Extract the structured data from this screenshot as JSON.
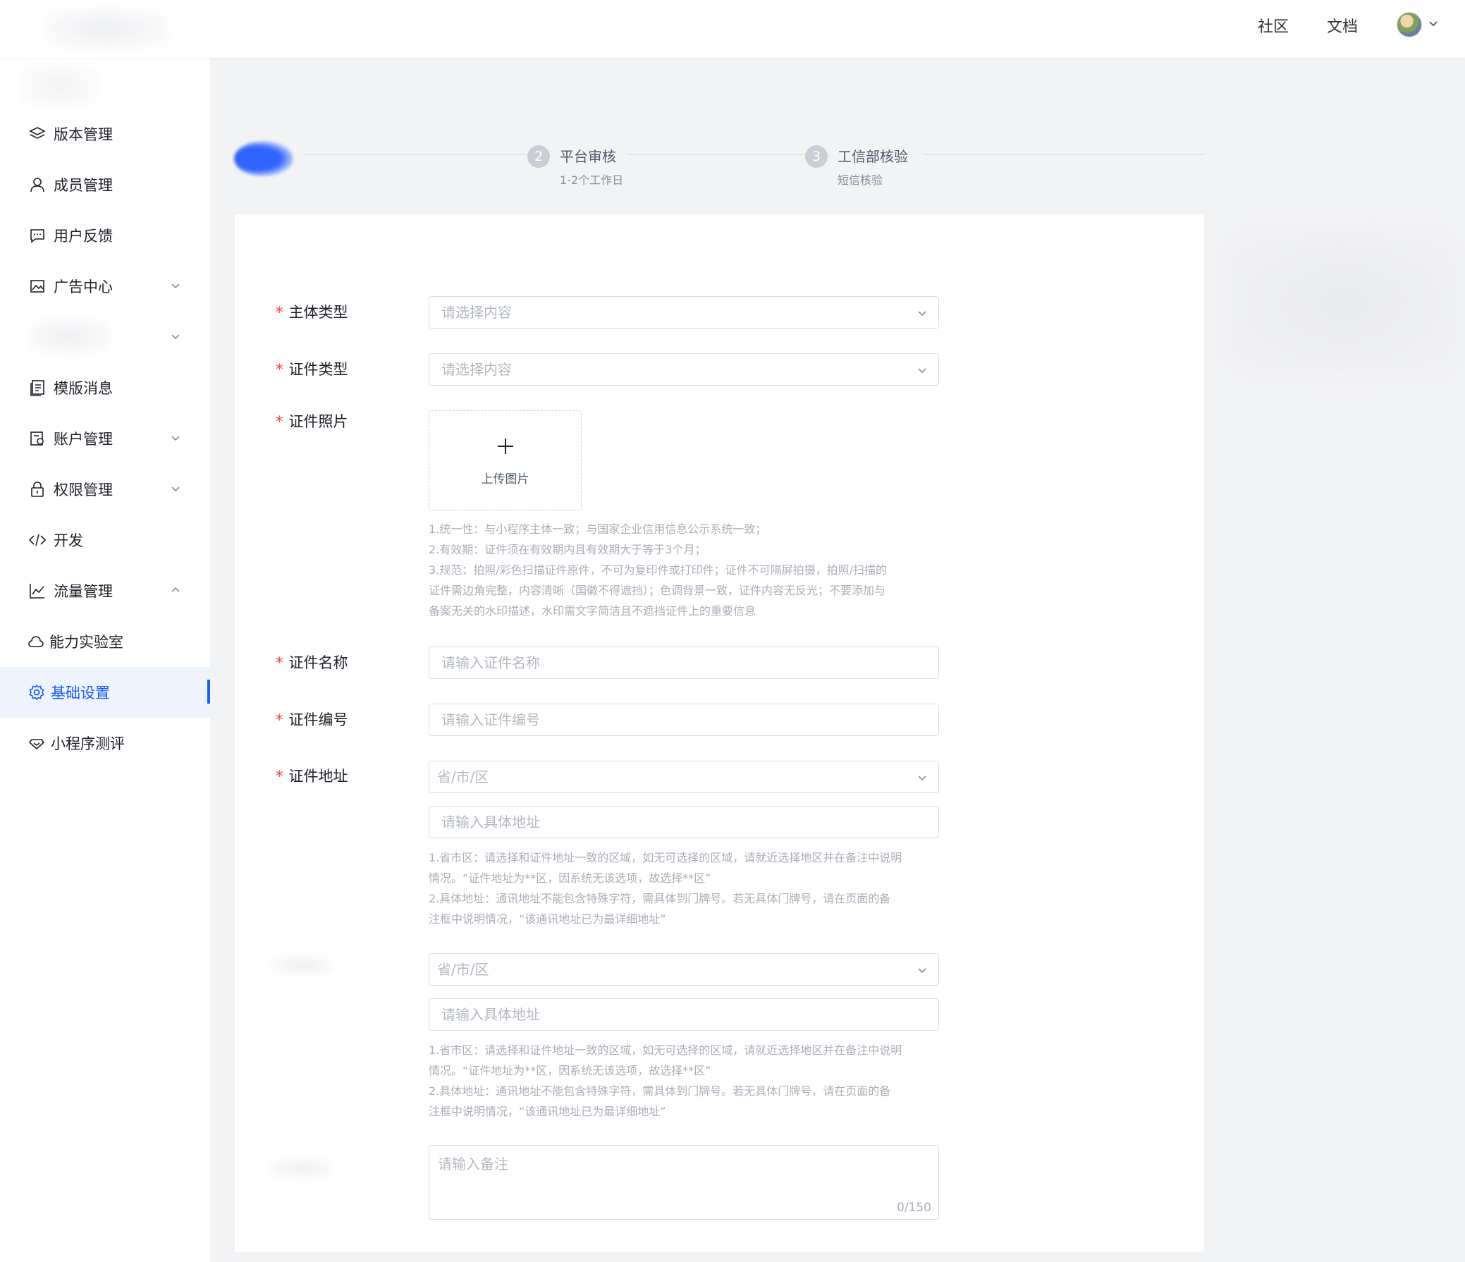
{
  "header": {
    "links": [
      "社区",
      "文档"
    ],
    "avatar_icon": "user-avatar"
  },
  "sidebar": {
    "items": [
      {
        "label": "版本管理",
        "icon": "layers-icon"
      },
      {
        "label": "成员管理",
        "icon": "user-icon"
      },
      {
        "label": "用户反馈",
        "icon": "message-icon"
      },
      {
        "label": "广告中心",
        "icon": "image-icon",
        "expandable": true
      },
      {
        "label": "",
        "icon": "",
        "expandable": true
      },
      {
        "label": "模版消息",
        "icon": "template-icon"
      },
      {
        "label": "账户管理",
        "icon": "account-icon",
        "expandable": true
      },
      {
        "label": "权限管理",
        "icon": "lock-icon",
        "expandable": true
      },
      {
        "label": "开发",
        "icon": "code-icon"
      },
      {
        "label": "流量管理",
        "icon": "chart-icon",
        "expanded": true
      },
      {
        "label": "能力实验室",
        "icon": "cloud-icon"
      },
      {
        "label": "基础设置",
        "icon": "gear-icon",
        "active": true
      },
      {
        "label": "小程序测评",
        "icon": "diamond-icon"
      }
    ]
  },
  "steps": [
    {
      "num": "",
      "title": "",
      "desc": ""
    },
    {
      "num": "2",
      "title": "平台审核",
      "desc": "1-2个工作日"
    },
    {
      "num": "3",
      "title": "工信部核验",
      "desc": "短信核验"
    }
  ],
  "form": {
    "subject_type": {
      "label": "主体类型",
      "placeholder": "请选择内容"
    },
    "cert_type": {
      "label": "证件类型",
      "placeholder": "请选择内容"
    },
    "cert_photo": {
      "label": "证件照片",
      "upload_text": "上传图片",
      "hints": [
        "1.统一性：与小程序主体一致；与国家企业信用信息公示系统一致；",
        "2.有效期：证件须在有效期内且有效期大于等于3个月；",
        "3.规范：拍照/彩色扫描证件原件，不可为复印件或打印件；证件不可隔屏拍摄，拍照/扫描的",
        "证件需边角完整，内容清晰（国徽不得遮挡）；色调背景一致，证件内容无反光；不要添加与",
        "备案无关的水印描述，水印需文字简洁且不遮挡证件上的重要信息"
      ]
    },
    "cert_name": {
      "label": "证件名称",
      "placeholder": "请输入证件名称"
    },
    "cert_number": {
      "label": "证件编号",
      "placeholder": "请输入证件编号"
    },
    "cert_address": {
      "label": "证件地址",
      "region_placeholder": "省/市/区",
      "detail_placeholder": "请输入具体地址",
      "hints": [
        "1.省市区：请选择和证件地址一致的区域，如无可选择的区域，请就近选择地区并在备注中说明",
        "情况。“证件地址为**区，因系统无该选项，故选择**区”",
        "2.具体地址：通讯地址不能包含特殊字符，需具体到门牌号。若无具体门牌号，请在页面的备",
        "注框中说明情况，“该通讯地址已为最详细地址”"
      ]
    },
    "contact_address": {
      "region_placeholder": "省/市/区",
      "detail_placeholder": "请输入具体地址",
      "hints": [
        "1.省市区：请选择和证件地址一致的区域，如无可选择的区域，请就近选择地区并在备注中说明",
        "情况。“证件地址为**区，因系统无该选项，故选择**区”",
        "2.具体地址：通讯地址不能包含特殊字符，需具体到门牌号。若无具体门牌号，请在页面的备",
        "注框中说明情况，“该通讯地址已为最详细地址”"
      ]
    },
    "remark": {
      "placeholder": "请输入备注",
      "counter": "0/150"
    }
  },
  "colors": {
    "accent": "#1a5cff",
    "required": "#f53f3f"
  }
}
